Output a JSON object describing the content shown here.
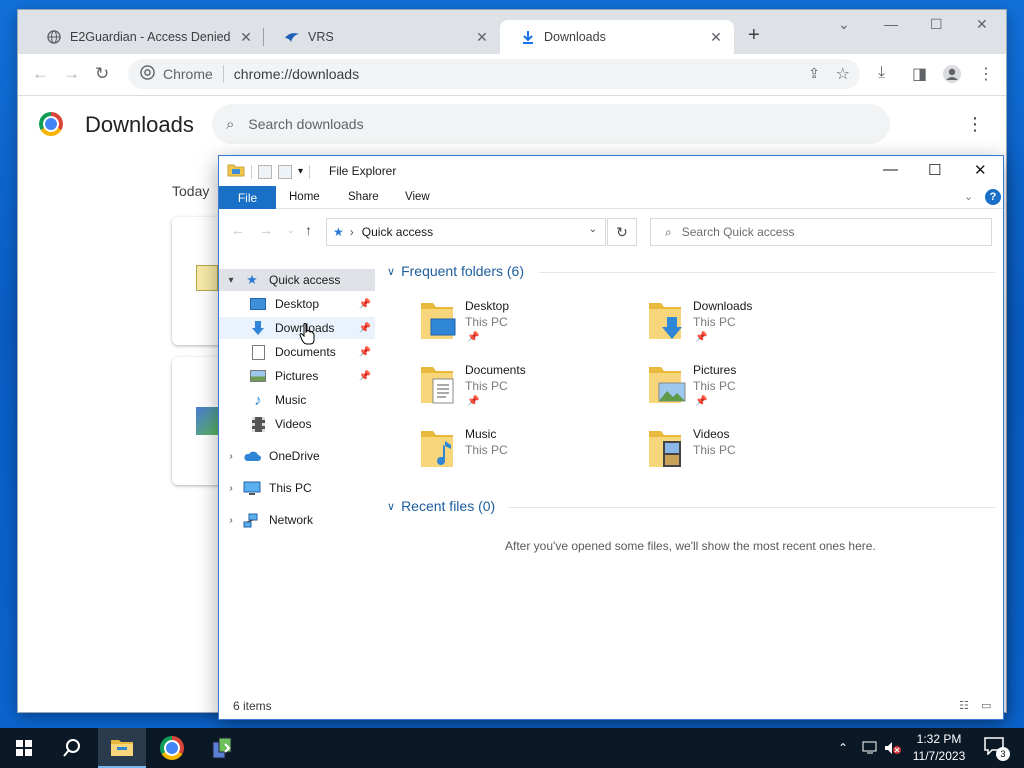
{
  "chrome": {
    "tabs": [
      {
        "label": "E2Guardian - Access Denied",
        "icon": "globe-icon"
      },
      {
        "label": "VRS",
        "icon": "vrs-icon"
      },
      {
        "label": "Downloads",
        "icon": "download-icon"
      }
    ],
    "omnibox": {
      "origin": "Chrome",
      "url": "chrome://downloads"
    },
    "page": {
      "title": "Downloads",
      "search_placeholder": "Search downloads",
      "section": "Today"
    }
  },
  "explorer": {
    "title": "File Explorer",
    "ribbon": {
      "file": "File",
      "tabs": [
        "Home",
        "Share",
        "View"
      ],
      "help": "?"
    },
    "address": "Quick access",
    "search_placeholder": "Search Quick access",
    "nav": {
      "quick_access": "Quick access",
      "pinned": [
        "Desktop",
        "Downloads",
        "Documents",
        "Pictures"
      ],
      "unpinned": [
        "Music",
        "Videos"
      ],
      "onedrive": "OneDrive",
      "this_pc": "This PC",
      "network": "Network"
    },
    "frequent": {
      "heading": "Frequent folders (6)",
      "items": [
        {
          "name": "Desktop",
          "location": "This PC",
          "pinned": true
        },
        {
          "name": "Downloads",
          "location": "This PC",
          "pinned": true
        },
        {
          "name": "Documents",
          "location": "This PC",
          "pinned": true
        },
        {
          "name": "Pictures",
          "location": "This PC",
          "pinned": true
        },
        {
          "name": "Music",
          "location": "This PC",
          "pinned": false
        },
        {
          "name": "Videos",
          "location": "This PC",
          "pinned": false
        }
      ]
    },
    "recent": {
      "heading": "Recent files (0)",
      "empty_message": "After you've opened some files, we'll show the most recent ones here."
    },
    "status": "6 items"
  },
  "taskbar": {
    "time": "1:32 PM",
    "date": "11/7/2023",
    "notifications": "3"
  },
  "colors": {
    "desktop": "#0b63cc",
    "accent": "#1a6fc7",
    "taskbar": "#0b1826"
  }
}
